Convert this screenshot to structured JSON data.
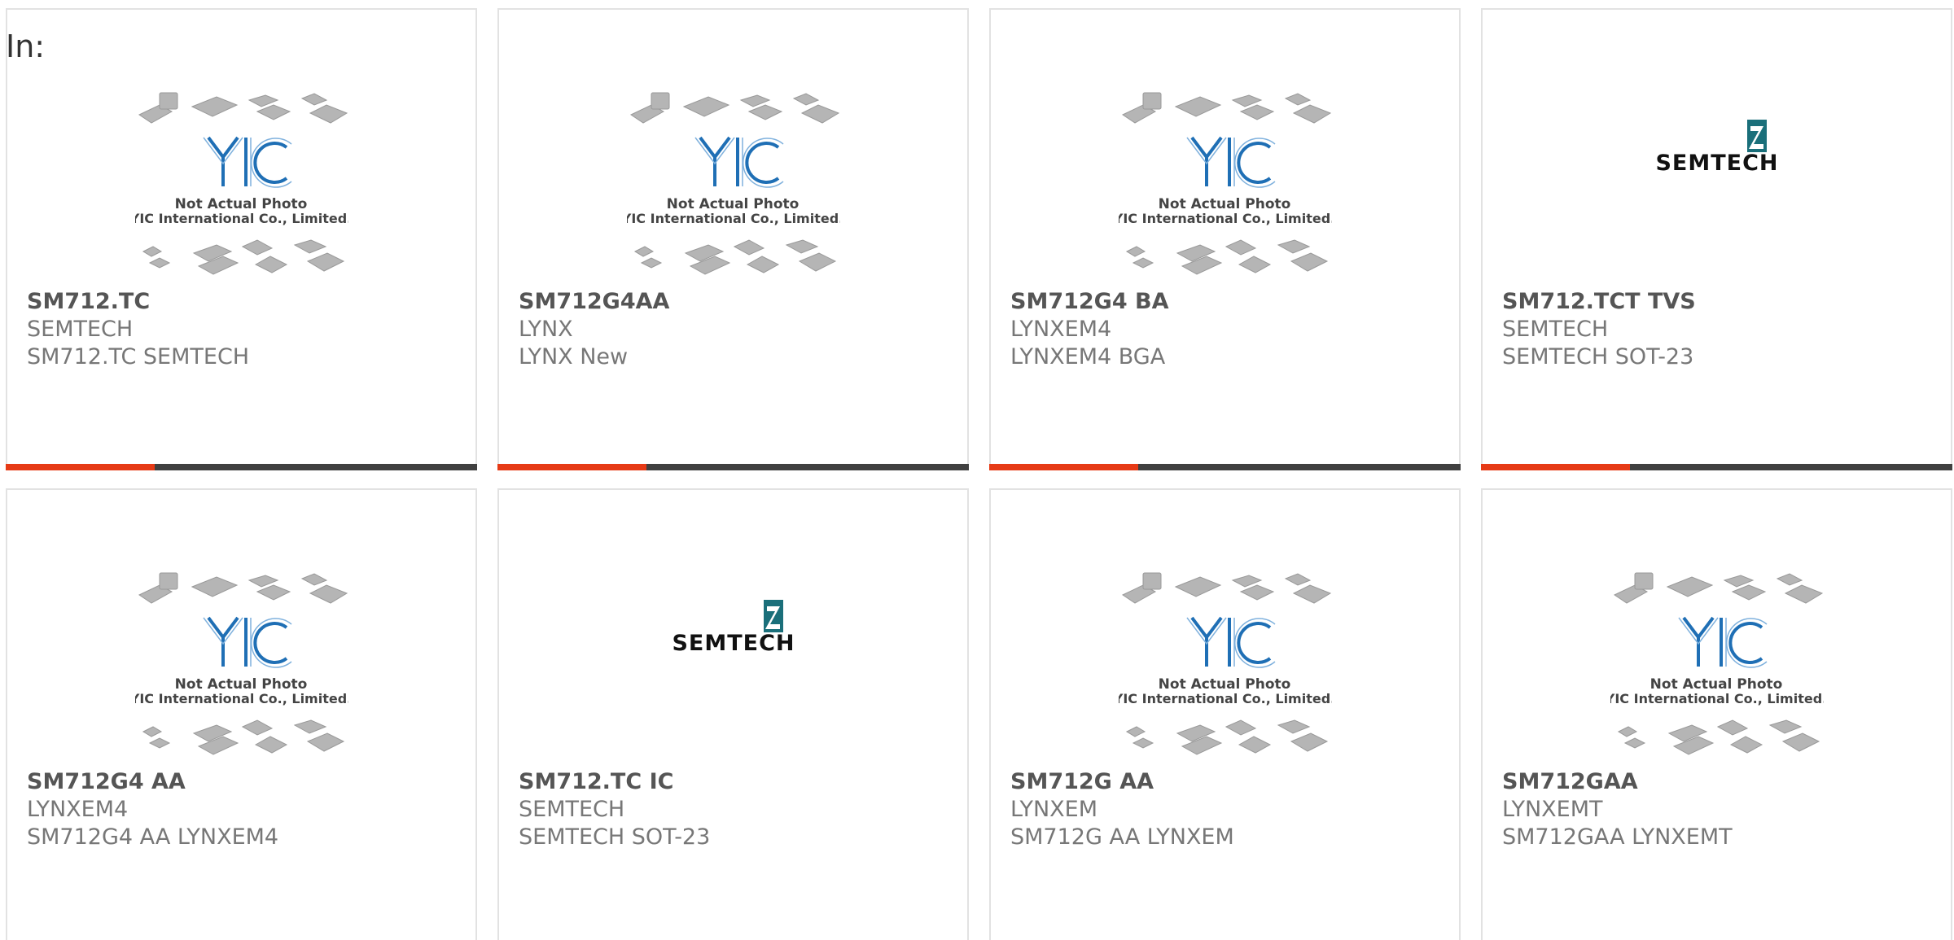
{
  "filter_label": "In:",
  "colors": {
    "accent": "#e63a16",
    "bar": "#404040",
    "yic_blue": "#1f6fb5",
    "semtech_teal": "#1a6f7a"
  },
  "placeholder_image": {
    "line1": "Not Actual Photo",
    "line2": "YIC International Co., Limited.",
    "logo_text": "YIC"
  },
  "semtech_logo_text": "SEMTECH",
  "products": [
    {
      "part_number": "SM712.TC",
      "manufacturer": "SEMTECH",
      "description": "SM712.TC SEMTECH",
      "image": "placeholder-image"
    },
    {
      "part_number": "SM712G4AA",
      "manufacturer": "LYNX",
      "description": "LYNX New",
      "image": "placeholder-image"
    },
    {
      "part_number": "SM712G4 BA",
      "manufacturer": "LYNXEM4",
      "description": "LYNXEM4 BGA",
      "image": "placeholder-image"
    },
    {
      "part_number": "SM712.TCT TVS",
      "manufacturer": "SEMTECH",
      "description": "SEMTECH SOT-23",
      "image": "semtech-logo"
    },
    {
      "part_number": "SM712G4 AA",
      "manufacturer": "LYNXEM4",
      "description": "SM712G4 AA LYNXEM4",
      "image": "placeholder-image"
    },
    {
      "part_number": "SM712.TC IC",
      "manufacturer": "SEMTECH",
      "description": "SEMTECH SOT-23",
      "image": "semtech-logo"
    },
    {
      "part_number": "SM712G AA",
      "manufacturer": "LYNXEM",
      "description": "SM712G AA LYNXEM",
      "image": "placeholder-image"
    },
    {
      "part_number": "SM712GAA",
      "manufacturer": "LYNXEMT",
      "description": "SM712GAA LYNXEMT",
      "image": "placeholder-image"
    }
  ]
}
